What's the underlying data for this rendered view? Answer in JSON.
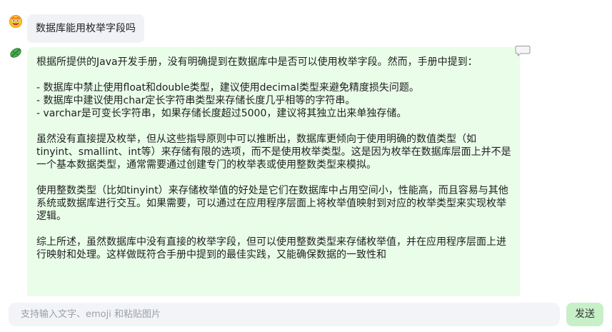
{
  "conversation": {
    "user_message": "数据库能用枚举字段吗",
    "bot_message": "根据所提供的Java开发手册，没有明确提到在数据库中是否可以使用枚举字段。然而，手册中提到：\n\n- 数据库中禁止使用float和double类型，建议使用decimal类型来避免精度损失问题。\n- 数据库中建议使用char定长字符串类型来存储长度几乎相等的字符串。\n- varchar是可变长字符串，如果存储长度超过5000，建议将其独立出来单独存储。\n\n虽然没有直接提及枚举，但从这些指导原则中可以推断出，数据库更倾向于使用明确的数值类型（如tinyint、smallint、int等）来存储有限的选项，而不是使用枚举类型。这是因为枚举在数据库层面上并不是一个基本数据类型，通常需要通过创建专门的枚举表或使用整数类型来模拟。\n\n使用整数类型（比如tinyint）来存储枚举值的好处是它们在数据库中占用空间小，性能高，而且容易与其他系统或数据库进行交互。如果需要，可以通过在应用程序层面上将枚举值映射到对应的枚举类型来实现枚举逻辑。\n\n综上所述，虽然数据库中没有直接的枚举字段，但可以使用整数类型来存储枚举值，并在应用程序层面上进行映射和处理。这样做既符合手册中提到的最佳实践，又能确保数据的一致性和"
  },
  "icons": {
    "user_avatar": "smiley-face-avatar-icon",
    "bot_avatar": "green-leaf-avatar-icon",
    "copy": "speech-bubble-icon"
  },
  "composer": {
    "placeholder": "支持输入文字、emoji 和粘贴图片",
    "send_label": "发送"
  },
  "colors": {
    "user_bubble": "#f1f2f6",
    "bot_bubble": "#e9fde9",
    "send_button": "#c8f0c8",
    "input_bg": "#f3f4f8"
  }
}
